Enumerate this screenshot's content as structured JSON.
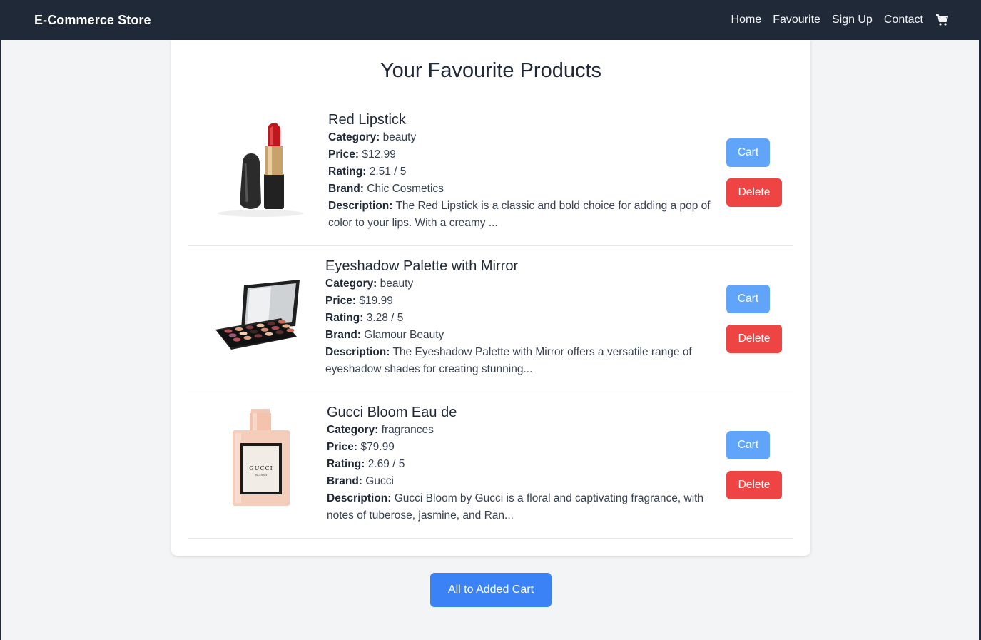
{
  "navbar": {
    "brand": "E-Commerce Store",
    "links": [
      "Home",
      "Favourite",
      "Sign Up",
      "Contact"
    ],
    "cart_icon": "cart-icon"
  },
  "page": {
    "title": "Your Favourite Products",
    "all_to_cart_label": "All to Added Cart"
  },
  "labels": {
    "category": "Category:",
    "price": "Price:",
    "rating": "Rating:",
    "brand": "Brand:",
    "description": "Description:",
    "cart_button": "Cart",
    "delete_button": "Delete"
  },
  "products": [
    {
      "name": "Red Lipstick",
      "category": "beauty",
      "price": "$12.99",
      "rating": "2.51 / 5",
      "brand": "Chic Cosmetics",
      "description": "The Red Lipstick is a classic and bold choice for adding a pop of color to your lips. With a creamy ..."
    },
    {
      "name": "Eyeshadow Palette with Mirror",
      "category": "beauty",
      "price": "$19.99",
      "rating": "3.28 / 5",
      "brand": "Glamour Beauty",
      "description": "The Eyeshadow Palette with Mirror offers a versatile range of eyeshadow shades for creating stunning..."
    },
    {
      "name": "Gucci Bloom Eau de",
      "category": "fragrances",
      "price": "$79.99",
      "rating": "2.69 / 5",
      "brand": "Gucci",
      "description": "Gucci Bloom by Gucci is a floral and captivating fragrance, with notes of tuberose, jasmine, and Ran...",
      "image_label_1": "GUCCI",
      "image_label_2": "BLOOM"
    }
  ],
  "colors": {
    "navbar_bg": "#1f2937",
    "cart_btn": "#60a5fa",
    "delete_btn": "#ef4444",
    "primary_btn": "#3b82f6"
  }
}
